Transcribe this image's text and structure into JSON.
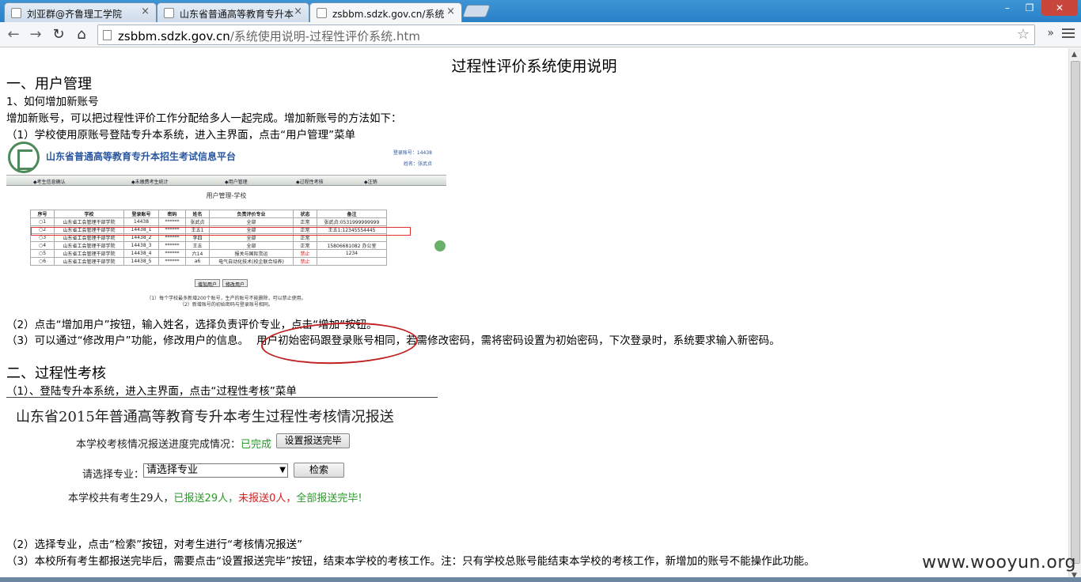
{
  "browser": {
    "tabs": [
      {
        "label": "刘亚群@齐鲁理工学院",
        "active": false
      },
      {
        "label": "山东省普通高等教育专升本",
        "active": false
      },
      {
        "label": "zsbbm.sdzk.gov.cn/系统",
        "active": true
      }
    ],
    "url_host": "zsbbm.sdzk.gov.cn",
    "url_path": "/系统使用说明-过程性评价系统.htm",
    "window_buttons": {
      "minimize": "–",
      "maximize": "❐",
      "close": "✕"
    },
    "ext_label": "»"
  },
  "page": {
    "title": "过程性评价系统使用说明",
    "s1_heading": "一、用户管理",
    "s1_sub": "1、如何增加新账号",
    "s1_intro": "增加新账号，可以把过程性评价工作分配给多人一起完成。增加新账号的方法如下：",
    "s1_step1": "（1）学校使用原账号登陆专升本系统，进入主界面，点击“用户管理”菜单",
    "s1_step2": "（2）点击“增加用户”按钮，输入姓名，选择负责评价专业，点击“增加”按钮。",
    "s1_step3a": "（3）可以通过“修改用户”功能，修改用户的信息。",
    "s1_step3b": "用户初始密码跟登录账号相同，",
    "s1_step3c": "若需修改密码，需将密码设置为初始密码，下次登录时，系统要求输入新密码。",
    "s2_heading": "二、过程性考核",
    "s2_step1": "（1）、登陆专升本系统，进入主界面，点击“过程性考核”菜单",
    "s2_step2": "（2）选择专业，点击“检索”按钮，对考生进行“考核情况报送”",
    "s2_step3": "（3）本校所有考生都报送完毕后，需要点击“设置报送完毕”按钮，结束本学校的考核工作。注：只有学校总账号能结束本学校的考核工作，新增加的账号不能操作此功能。"
  },
  "shot1": {
    "platform_title": "山东省普通高等教育专升本招生考试信息平台",
    "login_account": "登录账号：14438",
    "login_name": "姓名：张武贞",
    "nav": [
      "◆考生信息确认",
      "◆未缴费考生统计",
      "◆用户管理",
      "◆过程性考核",
      "◆注销"
    ],
    "caption": "用户管理-学校",
    "columns": [
      "序号",
      "学校",
      "登录账号",
      "密码",
      "姓名",
      "负责评价专业",
      "状态",
      "备注"
    ],
    "rows": [
      [
        "○1",
        "山东省工会管理干部学院",
        "14438",
        "******",
        "张武贞",
        "全部",
        "正常",
        "张武贞:0531999999999"
      ],
      [
        "○2",
        "山东省工会管理干部学院",
        "14438_1",
        "******",
        "王五1",
        "全部",
        "正常",
        "王五1:12345554445"
      ],
      [
        "○3",
        "山东省工会管理干部学院",
        "14438_2",
        "******",
        "李四",
        "全部",
        "正常",
        ""
      ],
      [
        "○4",
        "山东省工会管理干部学院",
        "14438_3",
        "******",
        "王五",
        "全部",
        "正常",
        "15806681082 办公室"
      ],
      [
        "○5",
        "山东省工会管理干部学院",
        "14438_4",
        "******",
        "六14",
        "报关与国际货运",
        "禁止",
        "1234"
      ],
      [
        "○6",
        "山东省工会管理干部学院",
        "14438_5",
        "******",
        "a6",
        "电气自动化技术(校企联合培养)",
        "禁止",
        ""
      ]
    ],
    "btn_add": "增加用户",
    "btn_edit": "修改用户",
    "note1": "（1）每个学校最多新增200个账号，生产的账号不能删除，可以禁止使用。",
    "note2": "（2）新增账号的初始密码与登录账号相同。"
  },
  "shot2": {
    "title": "山东省2015年普通高等教育专升本考生过程性考核情况报送",
    "progress_label": "本学校考核情况报送进度完成情况：",
    "progress_value": "已完成",
    "btn_set_done": "设置报送完毕",
    "select_label": "请选择专业：",
    "select_value": "请选择专业",
    "btn_search": "检索",
    "summary_total": "本学校共有考生29人，",
    "summary_sent": "已报送29人，",
    "summary_unsent": "未报送0人，",
    "summary_done": "全部报送完毕!"
  },
  "watermark": "www.wooyun.org"
}
